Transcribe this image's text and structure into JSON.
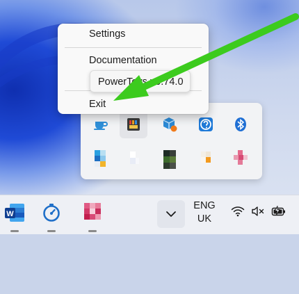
{
  "context_menu": {
    "items": [
      {
        "label": "Settings"
      },
      {
        "label": "Documentation"
      },
      {
        "label": "Exit"
      }
    ]
  },
  "tooltip": {
    "text": "PowerToys v0.74.0"
  },
  "tray_flyout": {
    "icons": [
      "coffee-cup-icon",
      "powertoys-icon",
      "package-update-icon",
      "help-icon",
      "bluetooth-icon",
      "blurred-app-icon-1",
      "blurred-app-icon-2",
      "blurred-app-icon-3",
      "blurred-app-icon-4",
      "blurred-app-icon-5"
    ]
  },
  "taskbar": {
    "apps": [
      "word-icon",
      "timer-app-icon",
      "blurred-app-icon"
    ],
    "language_line1": "ENG",
    "language_line2": "UK",
    "system_icons": [
      "wifi-icon",
      "speaker-muted-icon",
      "battery-charging-icon"
    ]
  },
  "colors": {
    "menu_bg": "#f9f9f9",
    "arrow": "#3ccb1e",
    "taskbar_bg": "#eef0f5",
    "accent_blue": "#0a6cd6"
  }
}
